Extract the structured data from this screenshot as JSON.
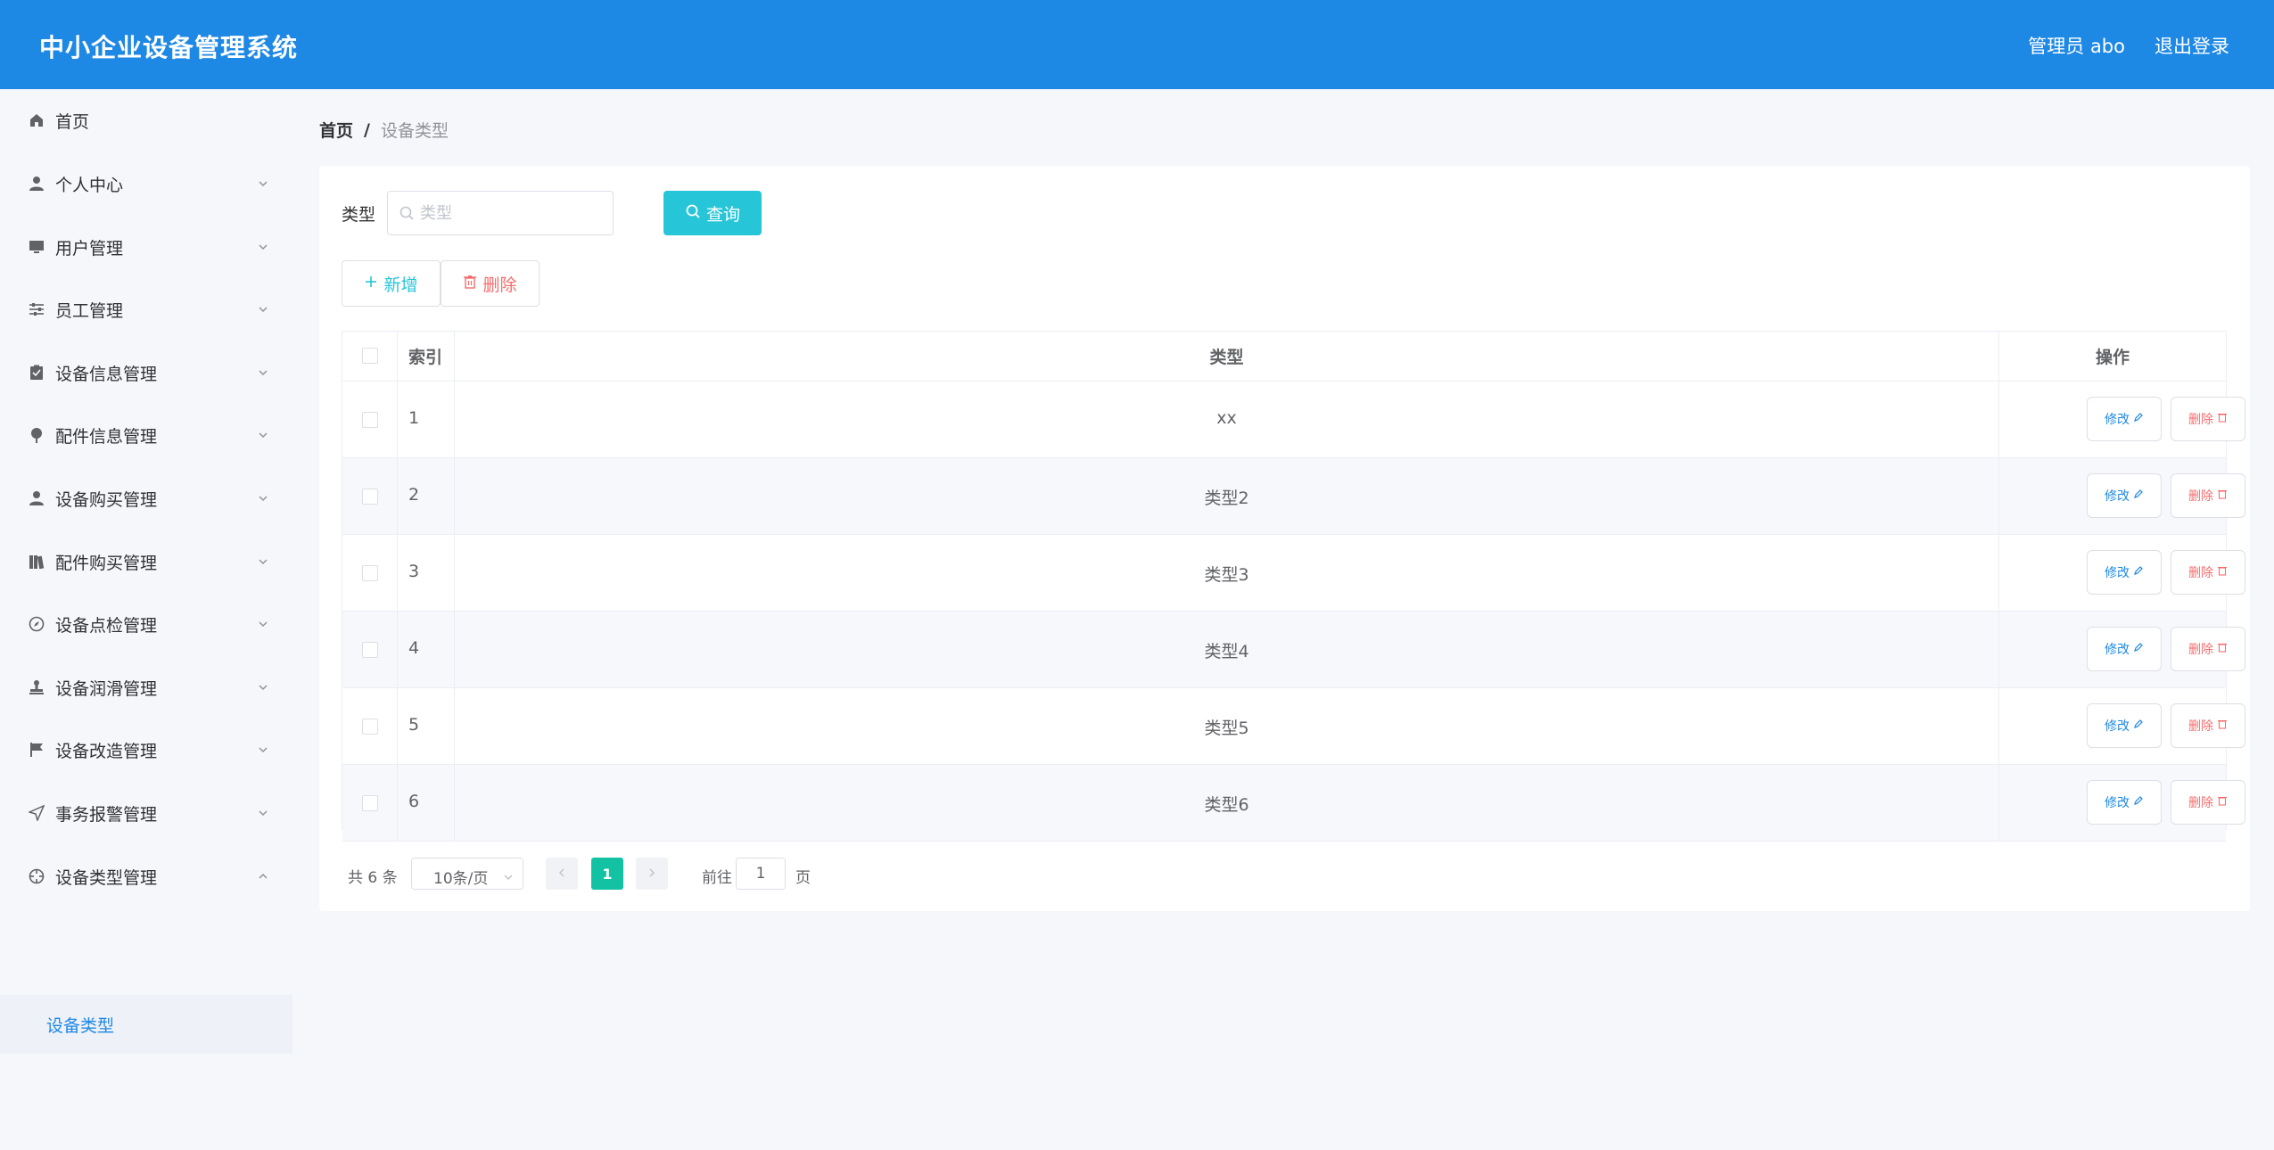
{
  "header": {
    "title": "中小企业设备管理系统",
    "admin": "管理员 abo",
    "logout": "退出登录",
    "bg_color": "#1e88e5"
  },
  "sidebar": {
    "items": [
      {
        "label": "首页",
        "icon": "home-icon"
      },
      {
        "label": "个人中心",
        "icon": "user-icon"
      },
      {
        "label": "用户管理",
        "icon": "monitor-icon"
      },
      {
        "label": "员工管理",
        "icon": "sliders-icon"
      },
      {
        "label": "设备信息管理",
        "icon": "clipboard-icon"
      },
      {
        "label": "配件信息管理",
        "icon": "pin-icon"
      },
      {
        "label": "设备购买管理",
        "icon": "person-icon"
      },
      {
        "label": "配件购买管理",
        "icon": "books-icon"
      },
      {
        "label": "设备点检管理",
        "icon": "compass-icon"
      },
      {
        "label": "设备润滑管理",
        "icon": "stamp-icon"
      },
      {
        "label": "设备改造管理",
        "icon": "flag-icon"
      },
      {
        "label": "事务报警管理",
        "icon": "send-icon"
      },
      {
        "label": "设备类型管理",
        "icon": "target-icon"
      }
    ],
    "submenu_active": "设备类型"
  },
  "breadcrumb": {
    "home": "首页",
    "sep": "/",
    "current": "设备类型"
  },
  "search": {
    "label": "类型",
    "placeholder": "类型",
    "query_label": "查询"
  },
  "actions": {
    "add_label": "新增",
    "delete_label": "删除"
  },
  "table": {
    "headers": {
      "index": "索引",
      "type": "类型",
      "ops": "操作"
    },
    "rows": [
      {
        "index": "1",
        "type": "xx"
      },
      {
        "index": "2",
        "type": "类型2"
      },
      {
        "index": "3",
        "type": "类型3"
      },
      {
        "index": "4",
        "type": "类型4"
      },
      {
        "index": "5",
        "type": "类型5"
      },
      {
        "index": "6",
        "type": "类型6"
      }
    ],
    "edit_label": "修改",
    "delete_label": "删除"
  },
  "pagination": {
    "total": "共 6 条",
    "page_size": "10条/页",
    "current": "1",
    "goto_label": "前往",
    "goto_value": "1",
    "page_label": "页"
  }
}
